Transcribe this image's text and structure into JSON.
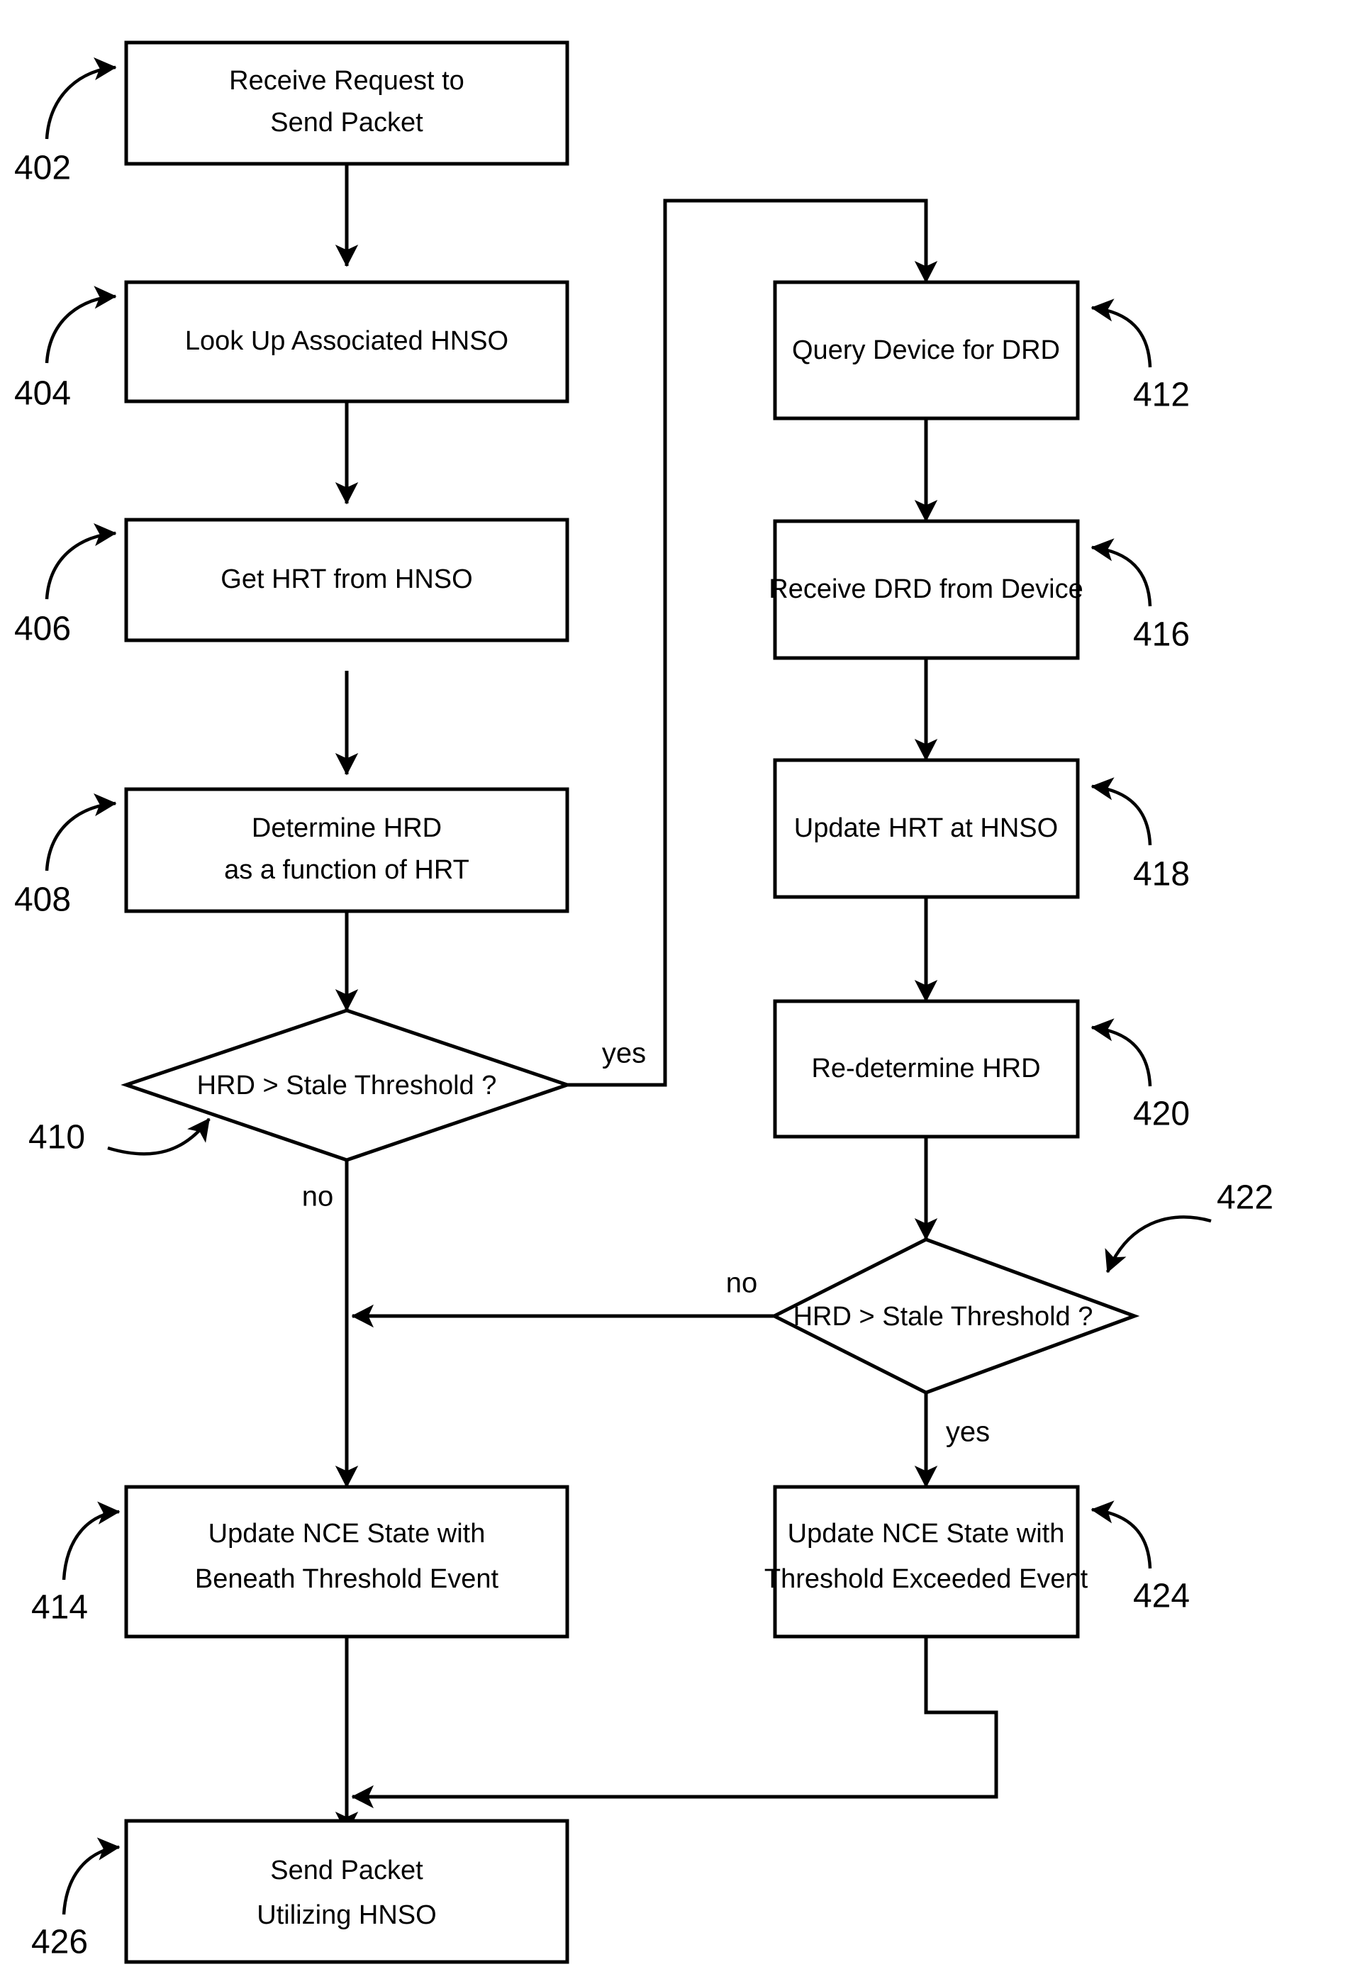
{
  "figure": {
    "type": "patent-flowchart",
    "background_color": "#ffffff",
    "line_color": "#000000"
  },
  "nodes": [
    {
      "id": "n402",
      "ref": "402",
      "shape": "process",
      "lines": [
        "Receive Request to",
        "Send Packet"
      ]
    },
    {
      "id": "n404",
      "ref": "404",
      "shape": "process",
      "lines": [
        "Look Up Associated HNSO"
      ]
    },
    {
      "id": "n406",
      "ref": "406",
      "shape": "process",
      "lines": [
        "Get HRT from HNSO"
      ]
    },
    {
      "id": "n408",
      "ref": "408",
      "shape": "process",
      "lines": [
        "Determine HRD",
        "as a function of HRT"
      ]
    },
    {
      "id": "n410",
      "ref": "410",
      "shape": "decision",
      "lines": [
        "HRD > Stale Threshold ?"
      ]
    },
    {
      "id": "n412",
      "ref": "412",
      "shape": "process",
      "lines": [
        "Query Device for DRD"
      ]
    },
    {
      "id": "n416",
      "ref": "416",
      "shape": "process",
      "lines": [
        "Receive DRD from Device"
      ]
    },
    {
      "id": "n418",
      "ref": "418",
      "shape": "process",
      "lines": [
        "Update HRT at HNSO"
      ]
    },
    {
      "id": "n420",
      "ref": "420",
      "shape": "process",
      "lines": [
        "Re-determine HRD"
      ]
    },
    {
      "id": "n422",
      "ref": "422",
      "shape": "decision",
      "lines": [
        "HRD > Stale Threshold ?"
      ]
    },
    {
      "id": "n414",
      "ref": "414",
      "shape": "process",
      "lines": [
        "Update NCE State with",
        "Beneath Threshold Event"
      ]
    },
    {
      "id": "n424",
      "ref": "424",
      "shape": "process",
      "lines": [
        "Update NCE State with",
        "Threshold Exceeded Event"
      ]
    },
    {
      "id": "n426",
      "ref": "426",
      "shape": "process",
      "lines": [
        "Send Packet",
        "Utilizing HNSO"
      ]
    }
  ],
  "edge_labels": {
    "yes_410": "yes",
    "no_410": "no",
    "no_422": "no",
    "yes_422": "yes"
  }
}
